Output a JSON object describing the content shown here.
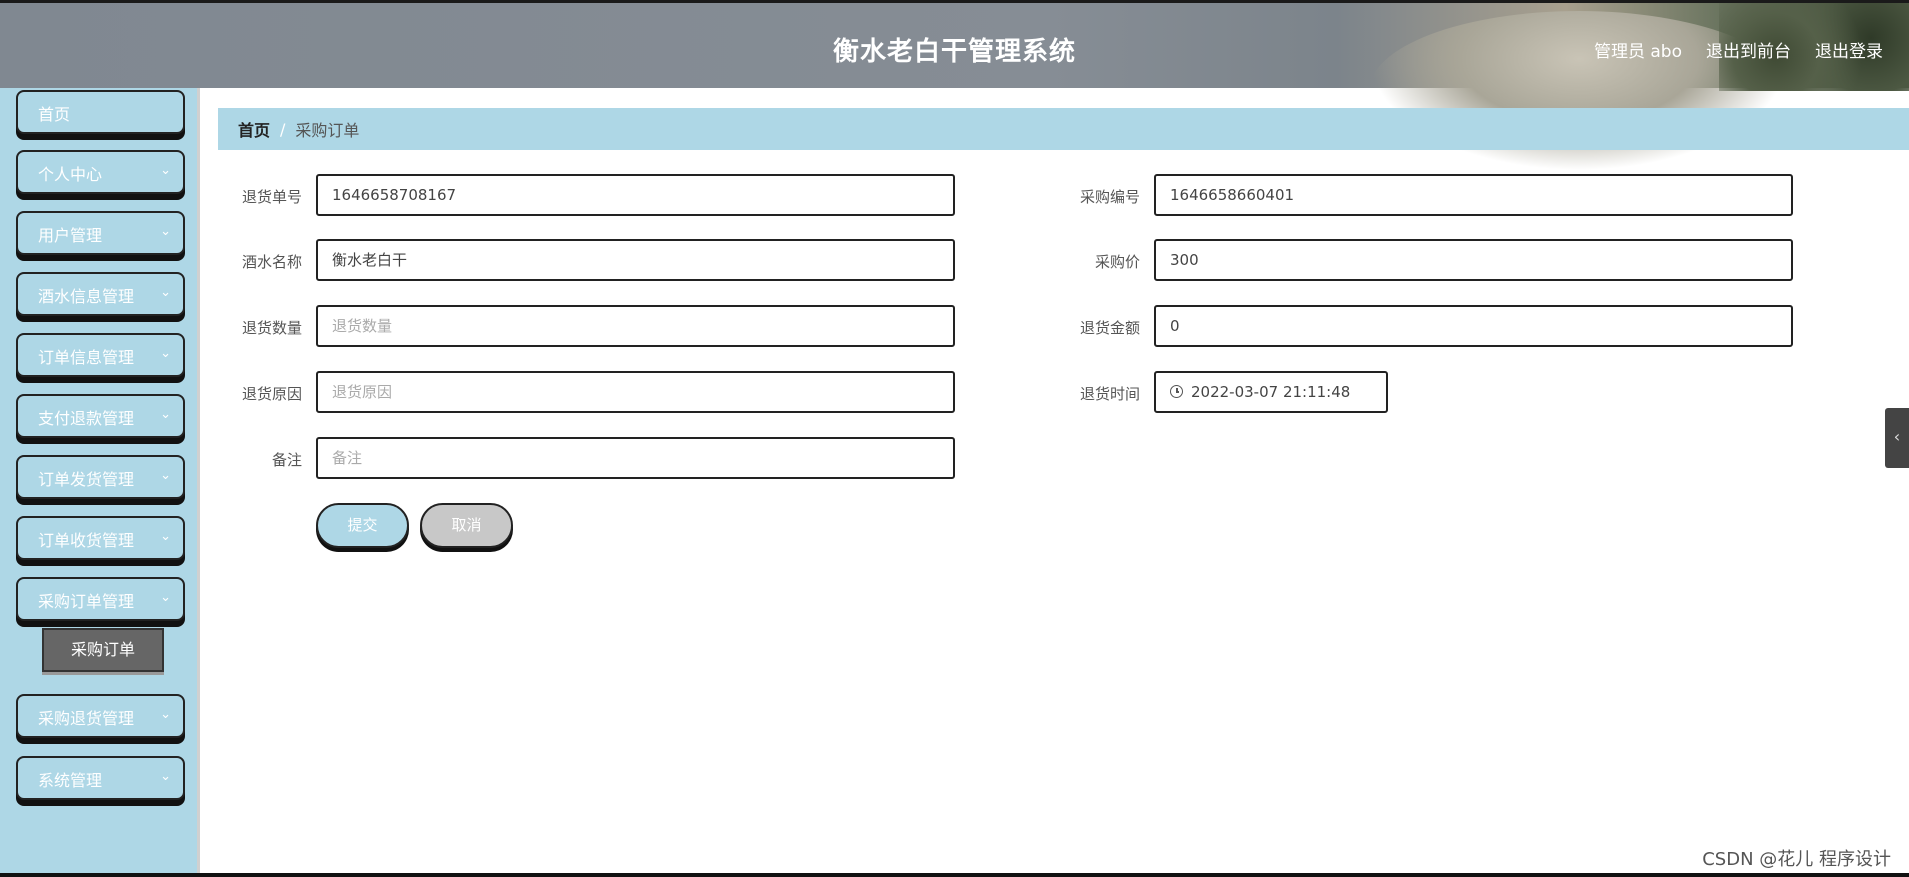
{
  "header": {
    "title": "衡水老白干管理系统",
    "nav": [
      "管理员 abo",
      "退出到前台",
      "退出登录"
    ]
  },
  "sidebar": {
    "items": [
      {
        "label": "首页",
        "chevron": false
      },
      {
        "label": "个人中心",
        "chevron": true
      },
      {
        "label": "用户管理",
        "chevron": true
      },
      {
        "label": "酒水信息管理",
        "chevron": true
      },
      {
        "label": "订单信息管理",
        "chevron": true
      },
      {
        "label": "支付退款管理",
        "chevron": true
      },
      {
        "label": "订单发货管理",
        "chevron": true
      },
      {
        "label": "订单收货管理",
        "chevron": true
      },
      {
        "label": "采购订单管理",
        "chevron": true
      },
      {
        "label": "采购退货管理",
        "chevron": true
      },
      {
        "label": "系统管理",
        "chevron": true
      }
    ],
    "active_submenu": "采购订单"
  },
  "breadcrumb": {
    "home": "首页",
    "separator": "/",
    "current": "采购订单"
  },
  "form": {
    "return_no": {
      "label": "退货单号",
      "value": "1646658708167"
    },
    "purchase_no": {
      "label": "采购编号",
      "value": "1646658660401"
    },
    "drink_name": {
      "label": "酒水名称",
      "value": "衡水老白干"
    },
    "purchase_price": {
      "label": "采购价",
      "value": "300"
    },
    "return_qty": {
      "label": "退货数量",
      "placeholder": "退货数量"
    },
    "return_amount": {
      "label": "退货金额",
      "value": "0"
    },
    "return_reason": {
      "label": "退货原因",
      "placeholder": "退货原因"
    },
    "return_time": {
      "label": "退货时间",
      "value": "2022-03-07 21:11:48"
    },
    "remark": {
      "label": "备注",
      "placeholder": "备注"
    },
    "submit_label": "提交",
    "cancel_label": "取消"
  },
  "watermark": "CSDN @花儿 程序设计",
  "icons": {
    "chevron": "chevron-down-icon",
    "clock": "clock-icon",
    "side_toggle": "chevron-left-icon"
  },
  "colors": {
    "accent": "#aed7e6",
    "submenu_active": "#666666"
  }
}
